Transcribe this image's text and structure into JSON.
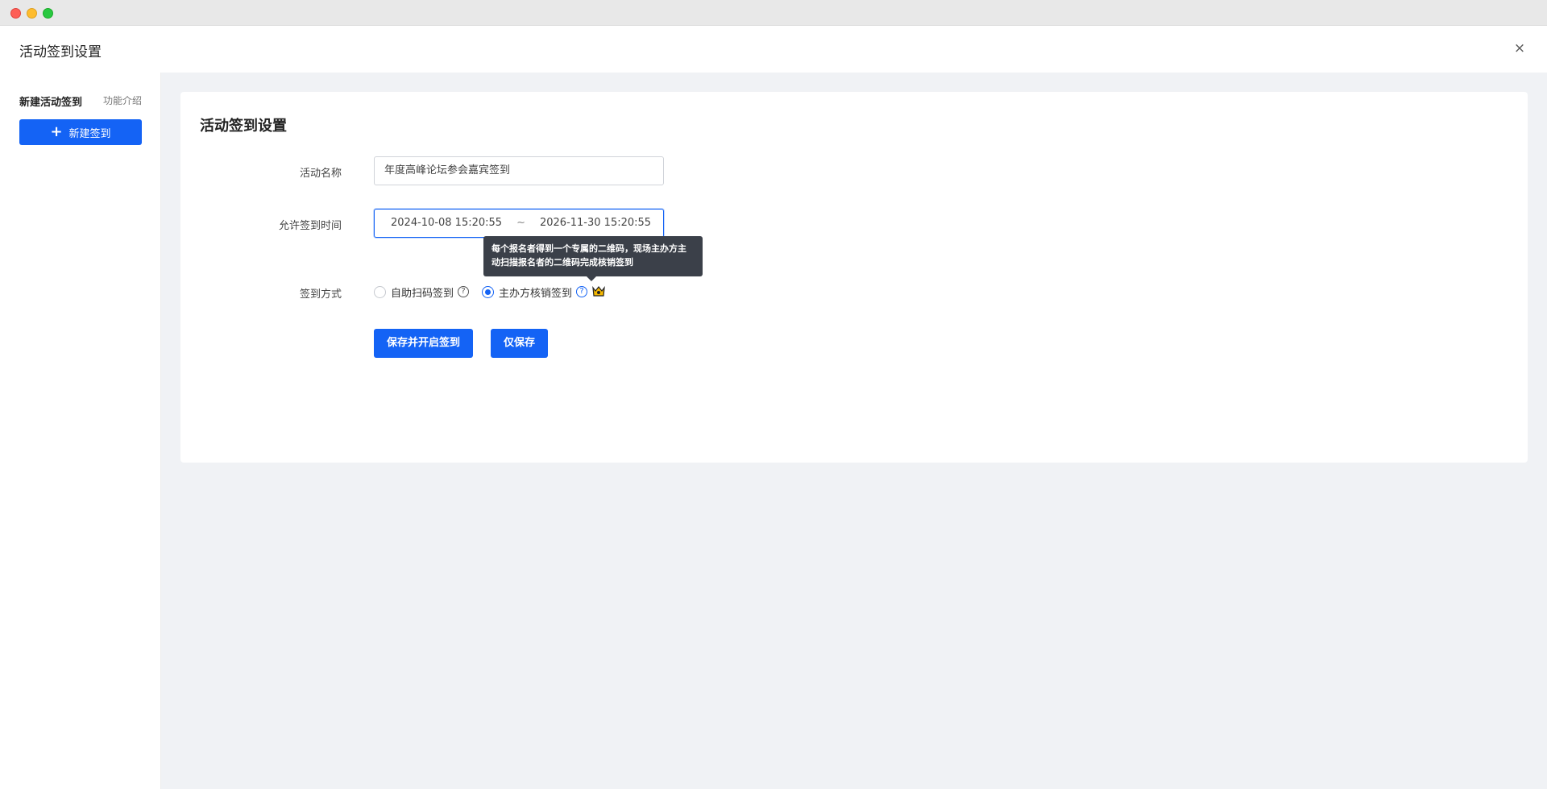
{
  "window": {
    "title": "活动签到设置",
    "close_symbol": "×"
  },
  "sidebar": {
    "heading": "新建活动签到",
    "intro_link": "功能介绍",
    "new_button": {
      "icon": "plus-icon",
      "label": "新建签到"
    }
  },
  "card": {
    "title": "活动签到设置",
    "fields": {
      "name": {
        "label": "活动名称",
        "value": "年度高峰论坛参会嘉宾签到"
      },
      "time": {
        "label": "允许签到时间",
        "start": "2024-10-08 15:20:55",
        "separator": "~",
        "end": "2026-11-30 15:20:55"
      },
      "method": {
        "label": "签到方式",
        "options": [
          {
            "label": "自助扫码签到",
            "checked": false
          },
          {
            "label": "主办方核销签到",
            "checked": true
          }
        ]
      }
    },
    "buttons": {
      "save_and_start": "保存并开启签到",
      "save_only": "仅保存"
    },
    "tooltip": "每个报名者得到一个专属的二维码，现场主办方主动扫描报名者的二维码完成核销签到"
  },
  "colors": {
    "primary": "#1463f5",
    "tooltip_bg": "#3b4049",
    "page_bg": "#f0f2f5"
  }
}
